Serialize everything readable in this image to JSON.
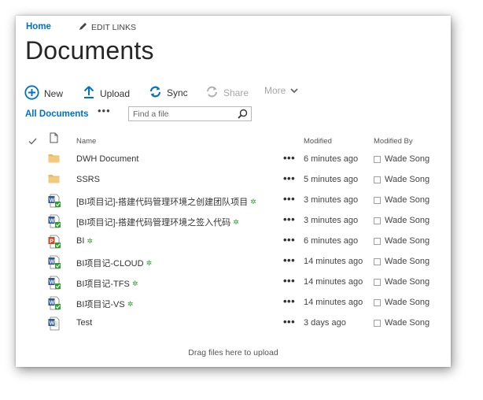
{
  "nav": {
    "home": "Home",
    "edit_links": "EDIT LINKS"
  },
  "page_title": "Documents",
  "commands": [
    {
      "key": "new",
      "label": "New",
      "icon": "plus-circle-icon",
      "enabled": true
    },
    {
      "key": "upload",
      "label": "Upload",
      "icon": "upload-arrow-icon",
      "enabled": true
    },
    {
      "key": "sync",
      "label": "Sync",
      "icon": "sync-icon",
      "enabled": true
    },
    {
      "key": "share",
      "label": "Share",
      "icon": "share-icon",
      "enabled": false
    },
    {
      "key": "more",
      "label": "More",
      "icon": "chevron-down-icon",
      "enabled": false
    }
  ],
  "views": {
    "current": "All Documents",
    "more": "•••"
  },
  "search": {
    "placeholder": "Find a file"
  },
  "columns": {
    "name": "Name",
    "modified": "Modified",
    "modified_by": "Modified By"
  },
  "files": [
    {
      "name": "DWH Document",
      "type": "folder",
      "is_new": false,
      "modified": "6 minutes ago",
      "modified_by": "Wade Song"
    },
    {
      "name": "SSRS",
      "type": "folder",
      "is_new": false,
      "modified": "5 minutes ago",
      "modified_by": "Wade Song"
    },
    {
      "name": "[BI项目记]-搭建代码管理环境之创建团队项目",
      "type": "word",
      "is_new": true,
      "modified": "3 minutes ago",
      "modified_by": "Wade Song"
    },
    {
      "name": "[BI项目记]-搭建代码管理环境之签入代码",
      "type": "word",
      "is_new": true,
      "modified": "3 minutes ago",
      "modified_by": "Wade Song"
    },
    {
      "name": "BI",
      "type": "powerpoint",
      "is_new": true,
      "modified": "6 minutes ago",
      "modified_by": "Wade Song"
    },
    {
      "name": "BI项目记-CLOUD",
      "type": "word",
      "is_new": true,
      "modified": "14 minutes ago",
      "modified_by": "Wade Song"
    },
    {
      "name": "BI项目记-TFS",
      "type": "word",
      "is_new": true,
      "modified": "14 minutes ago",
      "modified_by": "Wade Song"
    },
    {
      "name": "BI项目记-VS",
      "type": "word",
      "is_new": true,
      "modified": "14 minutes ago",
      "modified_by": "Wade Song"
    },
    {
      "name": "Test",
      "type": "word-plain",
      "is_new": false,
      "modified": "3 days ago",
      "modified_by": "Wade Song"
    }
  ],
  "row_more": "•••",
  "drag_hint": "Drag files here to upload",
  "colors": {
    "accent": "#0072c6",
    "folder": "#e8b86b",
    "word": "#2b579a",
    "powerpoint": "#d24726",
    "new_mark": "#2e9e2e"
  }
}
